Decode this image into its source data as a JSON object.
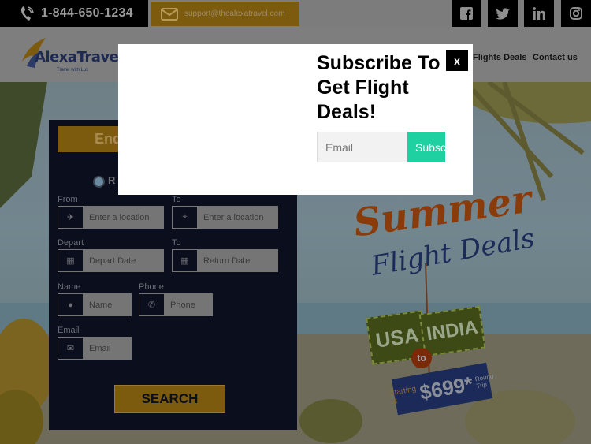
{
  "topbar": {
    "phone": "1-844-650-1234",
    "email": "support@thealexatravel.com",
    "social": [
      "facebook-icon",
      "twitter-icon",
      "linkedin-icon",
      "instagram-icon"
    ]
  },
  "nav": {
    "logo_text": "AlexaTravel",
    "logo_tagline": "Travel with Lux",
    "links": [
      "Flights Deals",
      "Contact us"
    ]
  },
  "booking": {
    "enquiry_label": "Enq",
    "trip_type": "R",
    "labels": {
      "from": "From",
      "to": "To",
      "depart": "Depart",
      "return_to": "To",
      "name": "Name",
      "phone": "Phone",
      "email": "Email"
    },
    "placeholders": {
      "from": "Enter a location",
      "to": "Enter a location",
      "depart": "Depart Date",
      "return": "Return Date",
      "name": "Name",
      "phone": "Phone",
      "email": "Email"
    },
    "search_label": "SEARCH"
  },
  "promo": {
    "summer": "Summer",
    "flight_deals": "Flight Deals",
    "from": "USA",
    "to_word": "to",
    "to": "INDIA",
    "starting_at": "Starting at",
    "price": "$699*",
    "round_trip": "Round Trip"
  },
  "modal": {
    "title": "Subscribe To Get Flight Deals!",
    "close_label": "x",
    "email_placeholder": "Email",
    "subscribe_label": "Subscribe"
  },
  "colors": {
    "accent_gold": "#f2b41b",
    "subscribe_green": "#1fd1a1",
    "navy": "#1b2a58"
  }
}
